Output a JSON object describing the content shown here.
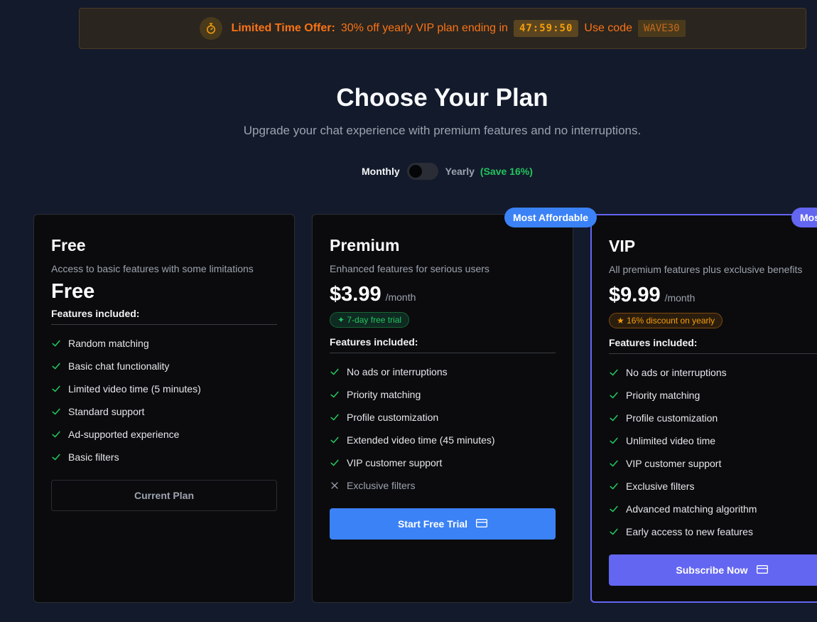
{
  "offer": {
    "lead": "Limited Time Offer:",
    "text": "30% off yearly VIP plan ending in",
    "countdown": "47:59:50",
    "use_code_label": "Use code",
    "code": "WAVE30",
    "icon": "stopwatch-icon"
  },
  "header": {
    "title": "Choose Your Plan",
    "subtitle": "Upgrade your chat experience with premium features and no interruptions."
  },
  "billing": {
    "monthly": "Monthly",
    "yearly": "Yearly",
    "save": "(Save 16%)",
    "selected": "Monthly"
  },
  "plans": {
    "free": {
      "name": "Free",
      "desc": "Access to basic features with some limitations",
      "price": "Free",
      "features_label": "Features included:",
      "features": [
        "Random matching",
        "Basic chat functionality",
        "Limited video time (5 minutes)",
        "Standard support",
        "Ad-supported experience",
        "Basic filters"
      ],
      "button": "Current Plan"
    },
    "premium": {
      "badge": "Most Affordable",
      "name": "Premium",
      "desc": "Enhanced features for serious users",
      "price": "$3.99",
      "per": "/month",
      "pill": "✦ 7-day free trial",
      "features_label": "Features included:",
      "features": [
        "No ads or interruptions",
        "Priority matching",
        "Profile customization",
        "Extended video time (45 minutes)",
        "VIP customer support"
      ],
      "excluded": [
        "Exclusive filters"
      ],
      "button": "Start Free Trial"
    },
    "vip": {
      "badge": "Mos",
      "name": "VIP",
      "desc": "All premium features plus exclusive benefits",
      "price": "$9.99",
      "per": "/month",
      "pill": "★ 16% discount on yearly",
      "features_label": "Features included:",
      "features": [
        "No ads or interruptions",
        "Priority matching",
        "Profile customization",
        "Unlimited video time",
        "VIP customer support",
        "Exclusive filters",
        "Advanced matching algorithm",
        "Early access to new features"
      ],
      "button": "Subscribe Now"
    }
  },
  "colors": {
    "accent_blue": "#3b82f6",
    "accent_indigo": "#6366f1",
    "check_green": "#22c55e",
    "offer_orange": "#f97316"
  }
}
